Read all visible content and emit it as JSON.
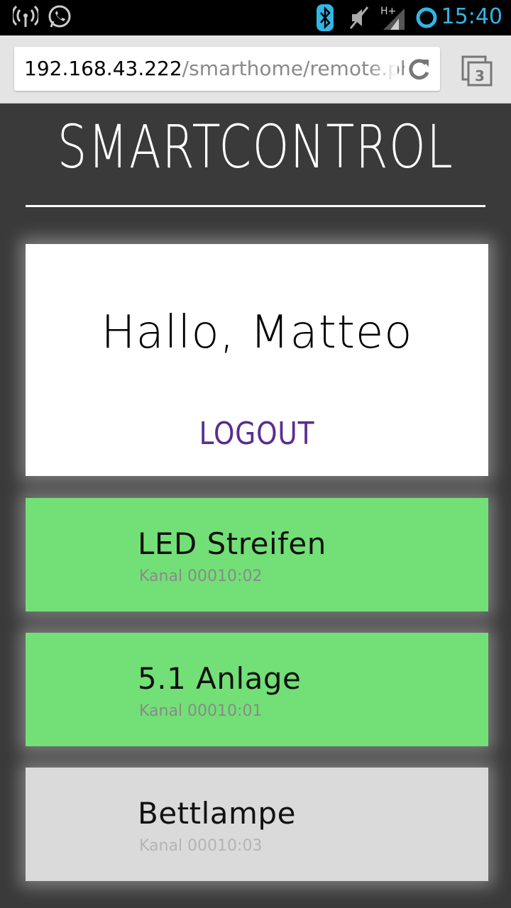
{
  "statusbar": {
    "time": "15:40",
    "network_label": "H+"
  },
  "browser": {
    "url_host": "192.168.43.222",
    "url_path": "/smarthome/remote.ph",
    "tab_count": "3"
  },
  "page": {
    "brand": "SMARTCONTROL",
    "greeting": "Hallo, Matteo",
    "logout_label": "LOGOUT"
  },
  "devices": [
    {
      "name": "LED Streifen",
      "channel": "Kanal 00010:02",
      "state": "on"
    },
    {
      "name": "5.1 Anlage",
      "channel": "Kanal 00010:01",
      "state": "on"
    },
    {
      "name": "Bettlampe",
      "channel": "Kanal 00010:03",
      "state": "off"
    }
  ],
  "colors": {
    "device_on": "#72e076",
    "device_off": "#dadada",
    "logout": "#5a2d91",
    "page_bg": "#3a3a3a",
    "status_accent": "#33b5e5"
  }
}
